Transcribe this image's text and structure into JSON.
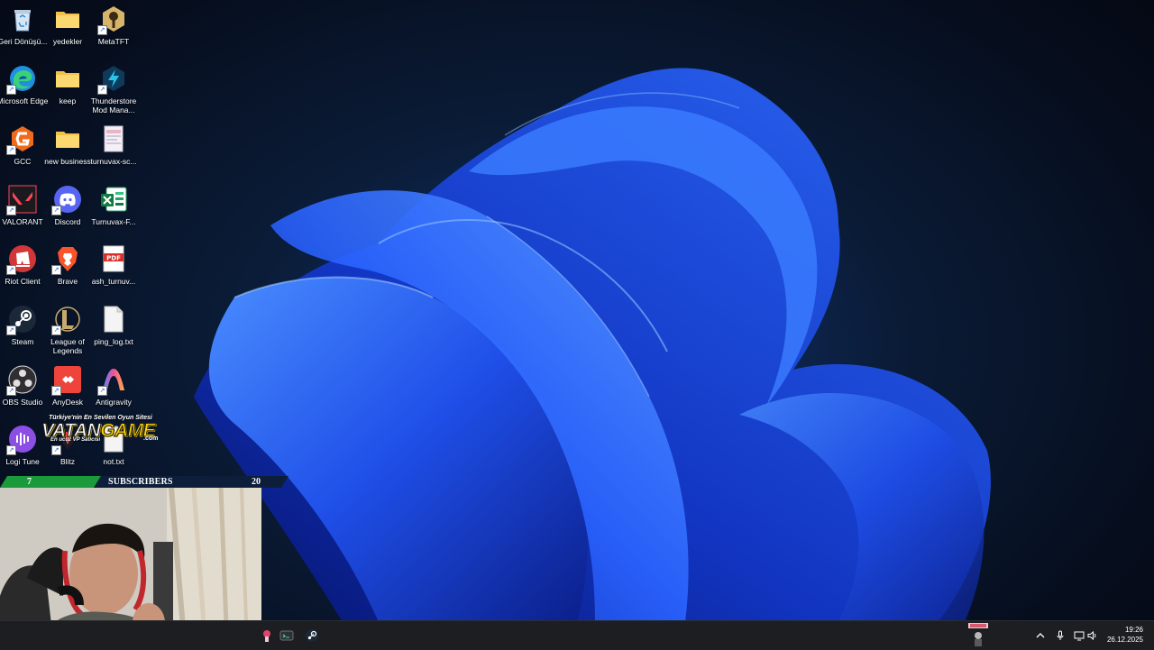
{
  "desktop_icons": [
    {
      "label": "Geri Dönüşü...",
      "icon": "recycle-bin-icon"
    },
    {
      "label": "yedekler",
      "icon": "folder-icon"
    },
    {
      "label": "MetaTFT",
      "icon": "metatft-icon"
    },
    {
      "label": "Microsoft Edge",
      "icon": "edge-icon"
    },
    {
      "label": "keep",
      "icon": "folder-icon"
    },
    {
      "label": "Thunderstore Mod Mana...",
      "icon": "thunderstore-icon"
    },
    {
      "label": "GCC",
      "icon": "gcc-icon"
    },
    {
      "label": "new business",
      "icon": "folder-icon"
    },
    {
      "label": "turnuvax-sc...",
      "icon": "image-file-icon"
    },
    {
      "label": "VALORANT",
      "icon": "valorant-icon"
    },
    {
      "label": "Discord",
      "icon": "discord-icon"
    },
    {
      "label": "Turnuvax-F...",
      "icon": "excel-icon"
    },
    {
      "label": "Riot Client",
      "icon": "riot-icon"
    },
    {
      "label": "Brave",
      "icon": "brave-icon"
    },
    {
      "label": "ash_turnuv...",
      "icon": "pdf-icon"
    },
    {
      "label": "Steam",
      "icon": "steam-icon"
    },
    {
      "label": "League of Legends",
      "icon": "league-icon"
    },
    {
      "label": "ping_log.txt",
      "icon": "text-file-icon"
    },
    {
      "label": "OBS Studio",
      "icon": "obs-icon"
    },
    {
      "label": "AnyDesk",
      "icon": "anydesk-icon"
    },
    {
      "label": "Antigravity",
      "icon": "antigravity-icon"
    },
    {
      "label": "Logi Tune",
      "icon": "logi-tune-icon"
    },
    {
      "label": "Blitz",
      "icon": "blitz-icon"
    },
    {
      "label": "not.txt",
      "icon": "text-file-icon"
    }
  ],
  "overlay": {
    "sub_count_left": "7",
    "sub_label": "SUBSCRIBERS",
    "sub_count_right": "20",
    "vatan": {
      "tagline": "Türkiye'nin En Sevilen Oyun Sitesi",
      "logo_a": "VATAN",
      "logo_b": "GAME",
      "com": ".com",
      "slogan": "En ucuz VP Satıcısı"
    }
  },
  "taskbar": {
    "pinned": [
      "app-icon",
      "terminal-icon",
      "steam-icon"
    ],
    "tray": [
      "chevron-up-icon",
      "microphone-icon",
      "display-icon",
      "speaker-icon"
    ],
    "time": "19:26",
    "date": "26.12.2025"
  },
  "colors": {
    "accent_blue": "#1f5bff",
    "sub_green": "#1a9a3a",
    "taskbar": "#1c1e22"
  }
}
